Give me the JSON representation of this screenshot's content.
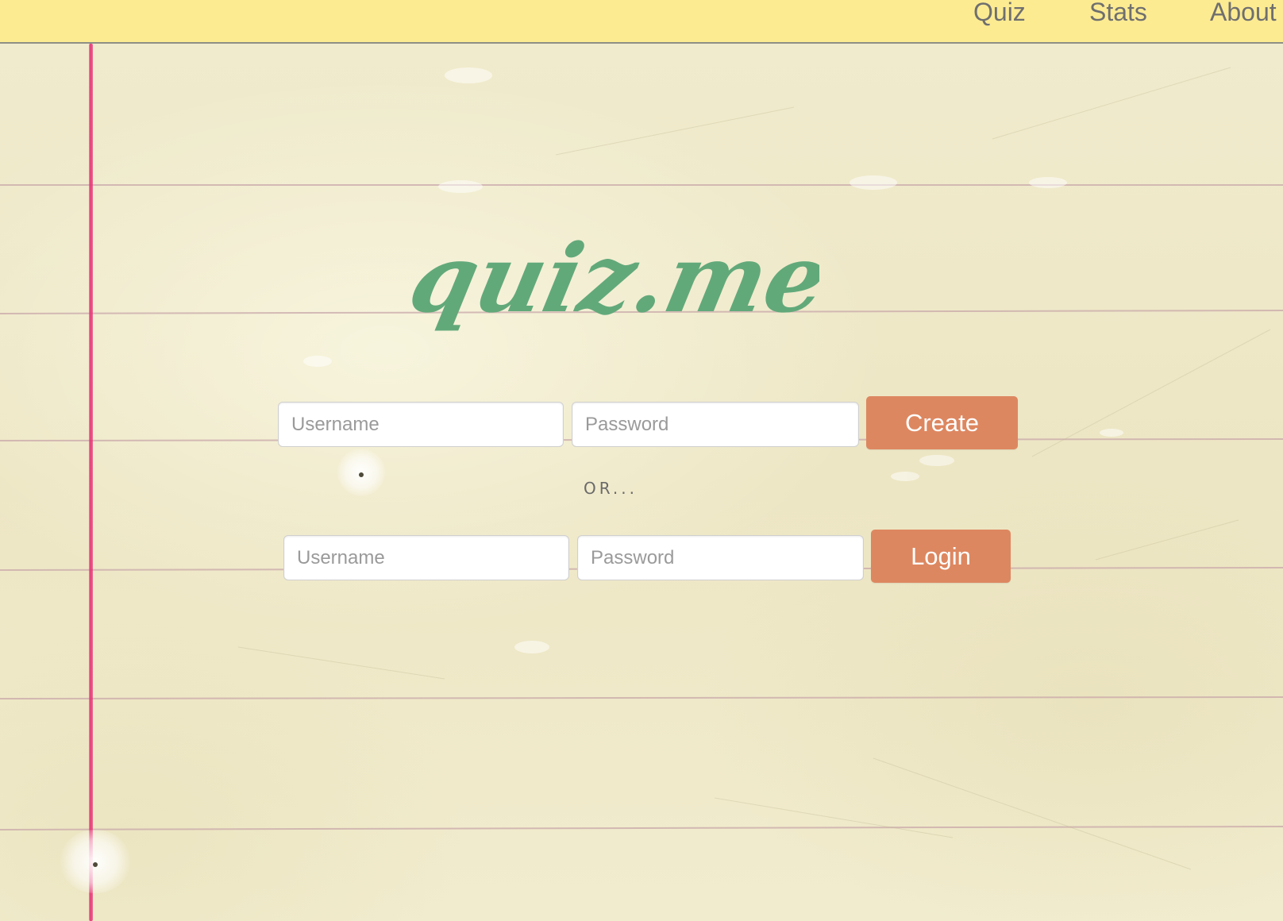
{
  "nav": {
    "items": [
      {
        "label": "Quiz"
      },
      {
        "label": "Stats"
      },
      {
        "label": "About"
      }
    ]
  },
  "logo": {
    "text": "quiz.me",
    "color": "#62a97a"
  },
  "create_form": {
    "username_placeholder": "Username",
    "password_placeholder": "Password",
    "button_label": "Create"
  },
  "divider": {
    "text": "OR..."
  },
  "login_form": {
    "username_placeholder": "Username",
    "password_placeholder": "Password",
    "button_label": "Login"
  },
  "colors": {
    "topbar": "#fdeb92",
    "button": "#dd8760",
    "margin_line": "#e8357a",
    "paper": "#efe9c9"
  }
}
